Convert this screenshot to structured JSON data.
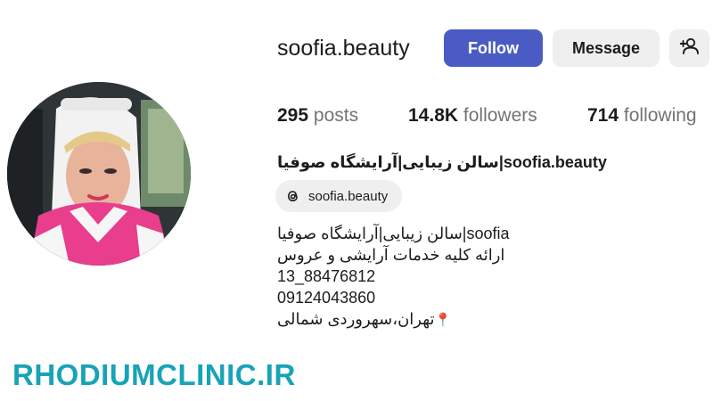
{
  "profile": {
    "username": "soofia.beauty",
    "follow_label": "Follow",
    "message_label": "Message",
    "suggest_icon": "person-add-icon",
    "stats": {
      "posts_count": "295",
      "posts_label": "posts",
      "followers_count": "14.8K",
      "followers_label": "followers",
      "following_count": "714",
      "following_label": "following"
    },
    "full_name": "سالن زیبایی|آرایشگاه صوفیا|soofia.beauty",
    "threads_handle": "soofia.beauty",
    "threads_icon": "threads-icon",
    "bio": {
      "line1": "سالن زیبایی|آرایشگاه صوفیا|soofia",
      "line2": "ارائه کلیه خدمات آرایشی و عروس",
      "line3": "13_88476812",
      "line4": "09124043860",
      "line5": "تهران،سهروردی شمالی",
      "line5_emoji": "📍"
    }
  },
  "watermark": "RHODIUMCLINIC.IR",
  "colors": {
    "follow_button": "#4a5cc4",
    "secondary_button": "#efefef",
    "muted_text": "#737373",
    "watermark": "#17a3b8"
  }
}
